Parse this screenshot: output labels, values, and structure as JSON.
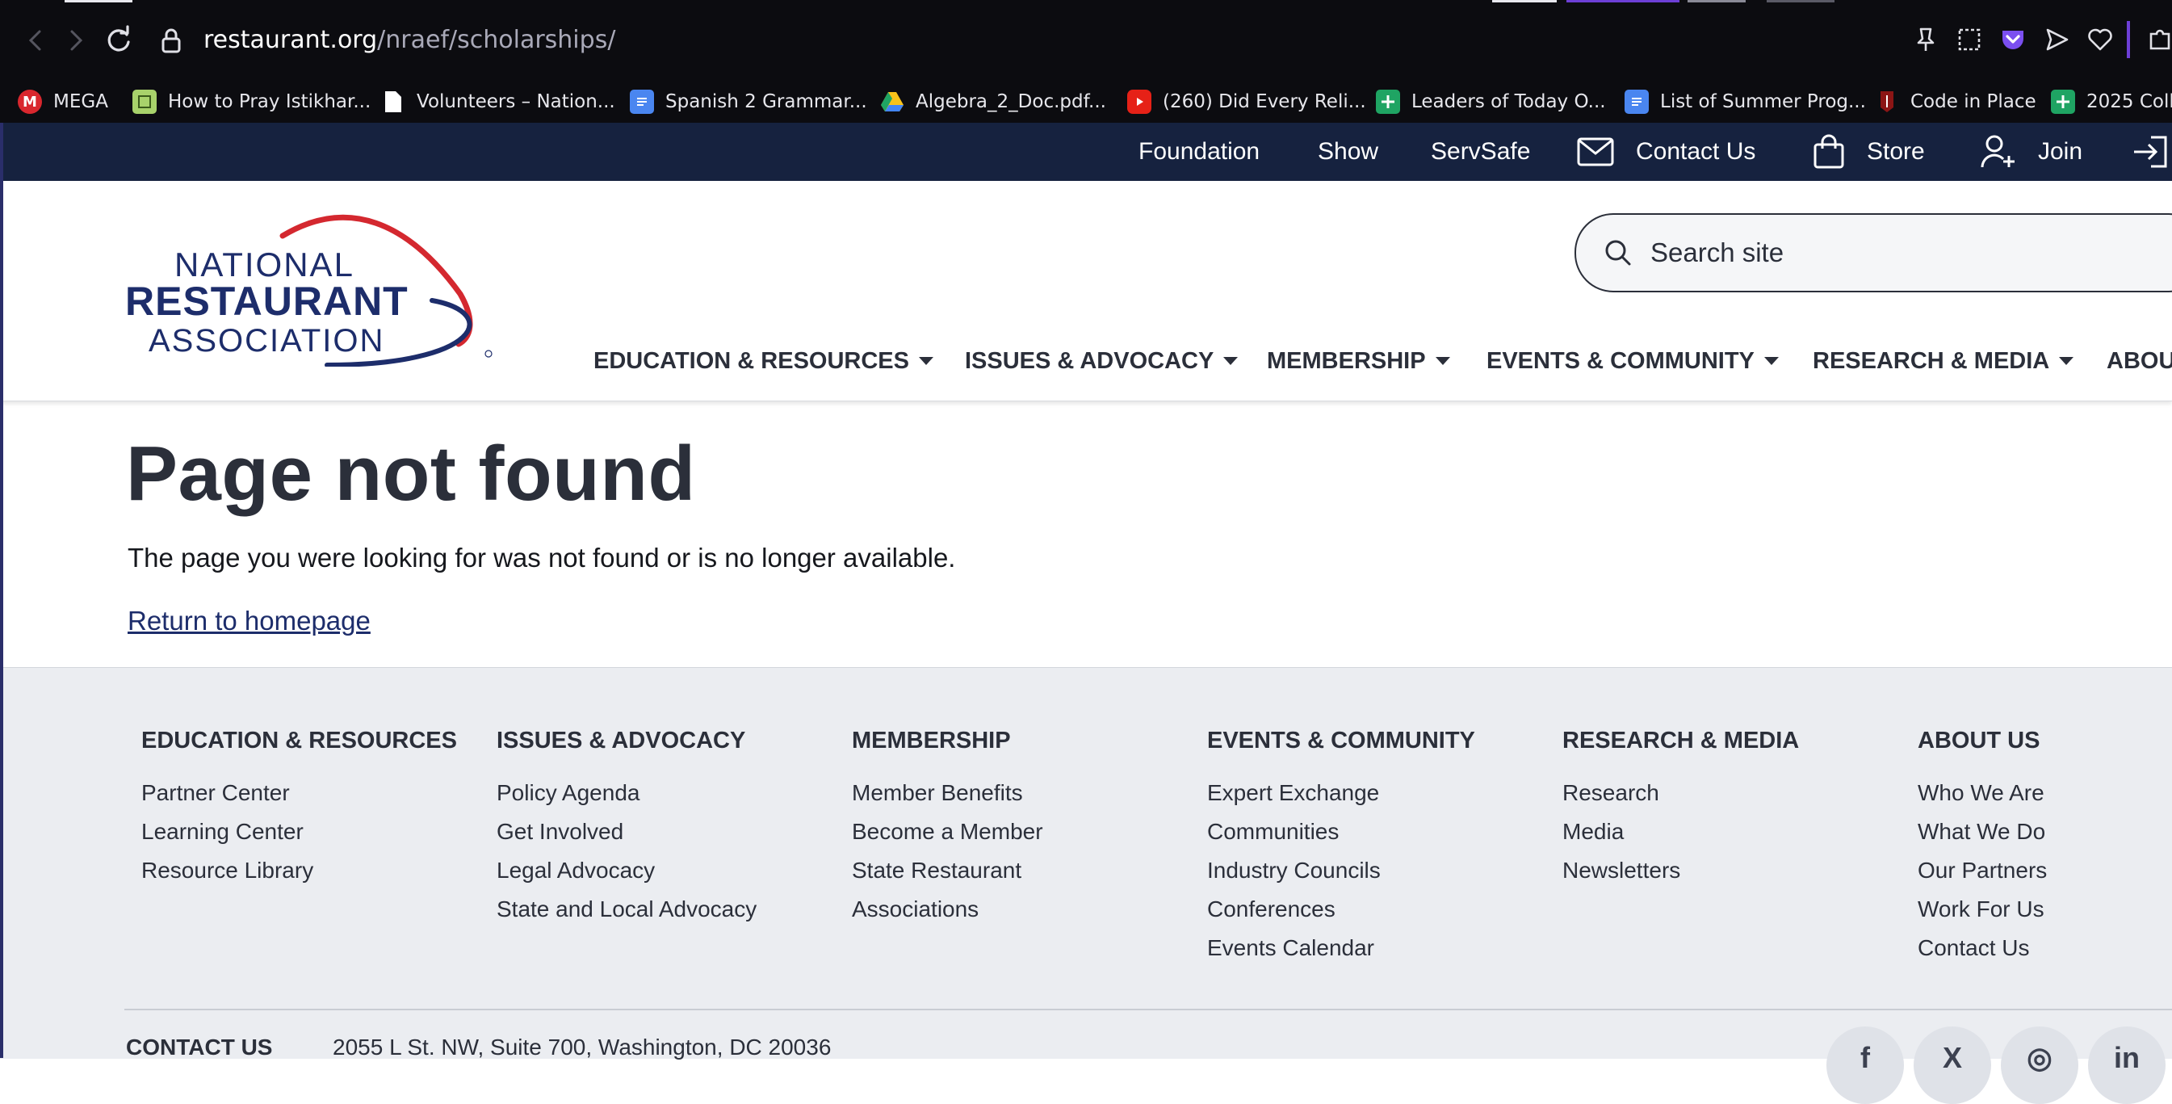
{
  "browser": {
    "url_host": "restaurant.org",
    "url_path": "/nraef/scholarships/",
    "bookmarks": [
      {
        "label": "MEGA",
        "icon": "mega-icon"
      },
      {
        "label": "How to Pray Istikhar...",
        "icon": "page-icon"
      },
      {
        "label": "Volunteers – Nation...",
        "icon": "document-icon"
      },
      {
        "label": "Spanish 2 Grammar...",
        "icon": "google-docs-icon"
      },
      {
        "label": "Algebra_2_Doc.pdf...",
        "icon": "google-drive-icon"
      },
      {
        "label": "(260) Did Every Reli...",
        "icon": "youtube-icon"
      },
      {
        "label": "Leaders of Today O...",
        "icon": "google-sheets-icon"
      },
      {
        "label": "List of Summer Prog...",
        "icon": "google-docs-icon"
      },
      {
        "label": "Code in Place",
        "icon": "stanford-icon"
      },
      {
        "label": "2025 Coll",
        "icon": "google-sheets-icon"
      }
    ]
  },
  "utility_nav": {
    "foundation": "Foundation",
    "show": "Show",
    "servsafe": "ServSafe",
    "contact": "Contact Us",
    "store": "Store",
    "join": "Join"
  },
  "header": {
    "logo": {
      "line1": "NATIONAL",
      "line2": "RESTAURANT",
      "line3": "ASSOCIATION",
      "mark": "®"
    },
    "search_placeholder": "Search site",
    "nav": [
      "EDUCATION & RESOURCES",
      "ISSUES & ADVOCACY",
      "MEMBERSHIP",
      "EVENTS & COMMUNITY",
      "RESEARCH & MEDIA",
      "ABOU"
    ]
  },
  "main": {
    "title": "Page not found",
    "message": "The page you were looking for was not found or is no longer available.",
    "home_link": "Return to homepage"
  },
  "footer": {
    "columns": [
      {
        "heading": "EDUCATION & RESOURCES",
        "links": [
          "Partner Center",
          "Learning Center",
          "Resource Library"
        ]
      },
      {
        "heading": "ISSUES & ADVOCACY",
        "links": [
          "Policy Agenda",
          "Get Involved",
          "Legal Advocacy",
          "State and Local Advocacy"
        ]
      },
      {
        "heading": "MEMBERSHIP",
        "links": [
          "Member Benefits",
          "Become a Member",
          "State Restaurant",
          "Associations"
        ]
      },
      {
        "heading": "EVENTS & COMMUNITY",
        "links": [
          "Expert Exchange",
          "Communities",
          "Industry Councils",
          "Conferences",
          "Events Calendar"
        ]
      },
      {
        "heading": "RESEARCH & MEDIA",
        "links": [
          "Research",
          "Media",
          "Newsletters"
        ]
      },
      {
        "heading": "ABOUT US",
        "links": [
          "Who We Are",
          "What We Do",
          "Our Partners",
          "Work For Us",
          "Contact Us"
        ]
      }
    ],
    "contact_label": "CONTACT US",
    "address": "2055 L St. NW, Suite 700, Washington, DC 20036",
    "social": [
      {
        "icon": "facebook-icon",
        "glyph": "f"
      },
      {
        "icon": "x-twitter-icon",
        "glyph": "X"
      },
      {
        "icon": "instagram-icon",
        "glyph": "◎"
      },
      {
        "icon": "linkedin-icon",
        "glyph": "in"
      }
    ]
  },
  "colors": {
    "utility_bar": "#16223f",
    "brand_navy": "#1d2d6b",
    "brand_red": "#d4282f",
    "text_dark": "#2b2f3a",
    "footer_bg": "#ebedf1"
  }
}
